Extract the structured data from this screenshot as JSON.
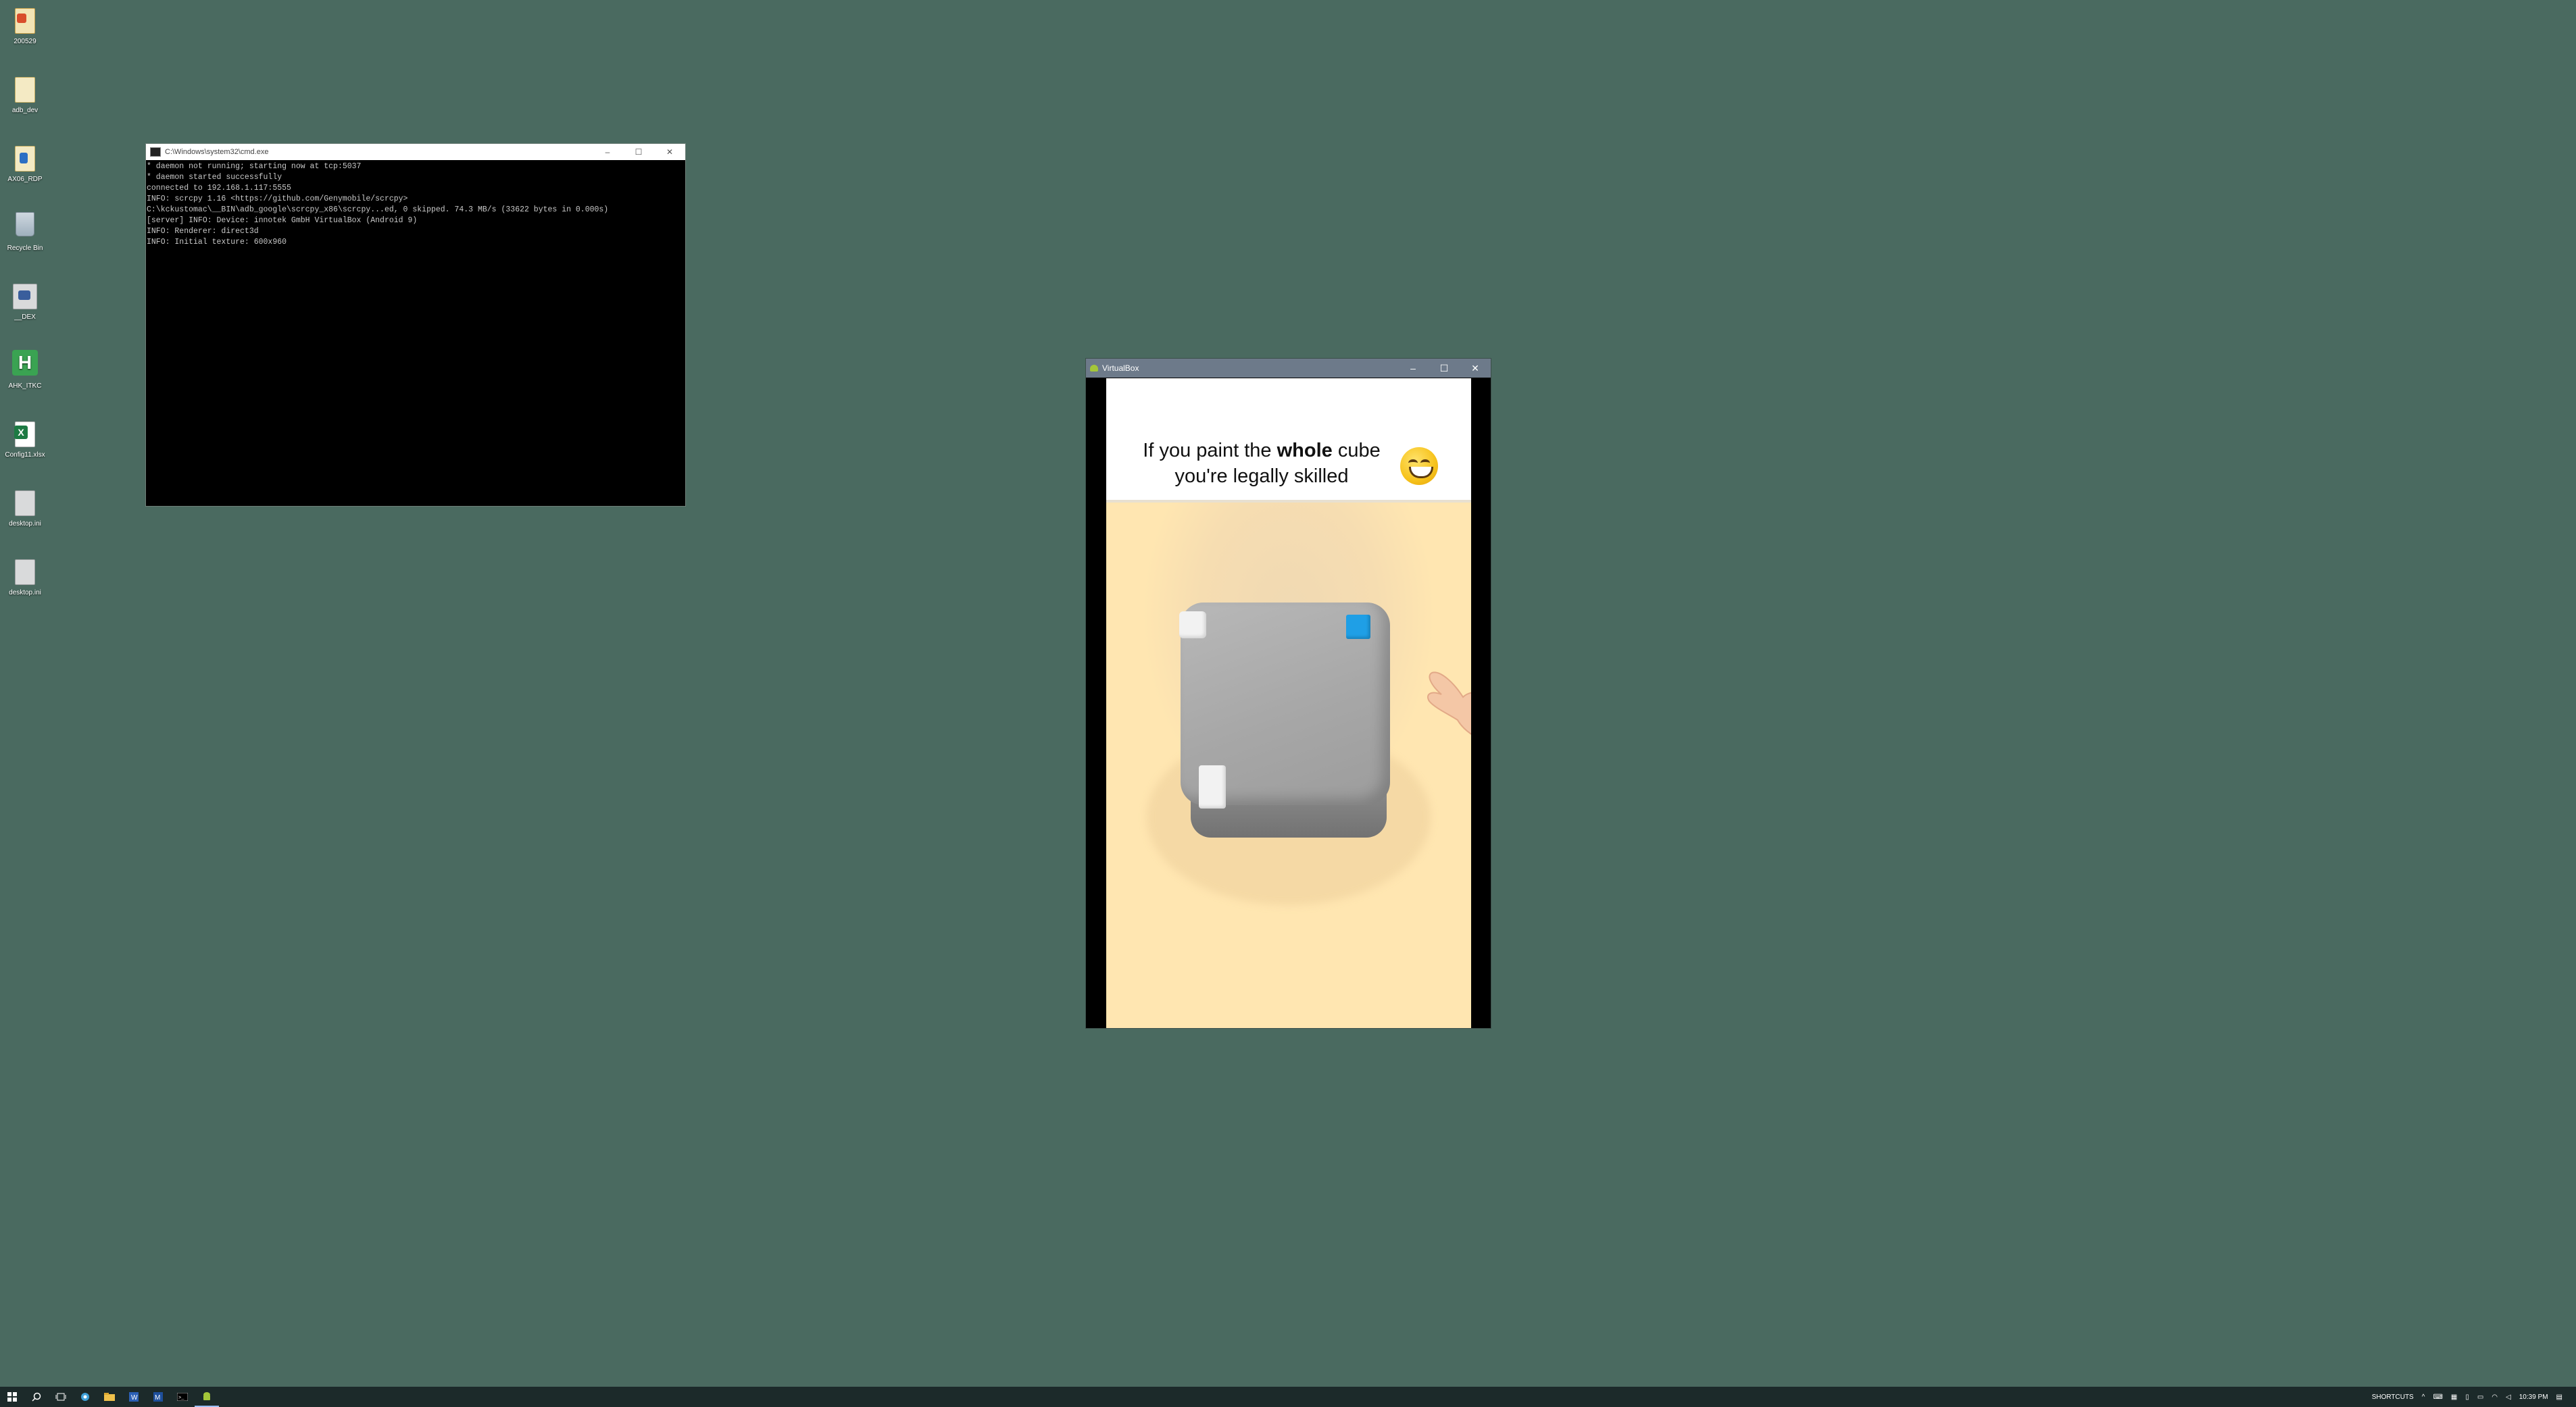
{
  "desktop": {
    "icons": [
      {
        "label": "200529",
        "icon": "folder-archive-icon"
      },
      {
        "label": "adb_dev",
        "icon": "text-file-icon"
      },
      {
        "label": "AX06_RDP",
        "icon": "remote-desktop-icon"
      },
      {
        "label": "Recycle Bin",
        "icon": "recycle-bin-icon"
      },
      {
        "label": "__DEX",
        "icon": "folder-shortcut-icon"
      },
      {
        "label": "AHK_ITKC",
        "icon": "autohotkey-icon"
      },
      {
        "label": "Config11.xlsx",
        "icon": "excel-file-icon"
      },
      {
        "label": "desktop.ini",
        "icon": "settings-file-icon"
      },
      {
        "label": "desktop.ini",
        "icon": "settings-file-icon"
      }
    ]
  },
  "cmd_window": {
    "title": "C:\\Windows\\system32\\cmd.exe",
    "lines": [
      "* daemon not running; starting now at tcp:5037",
      "* daemon started successfully",
      "connected to 192.168.1.117:5555",
      "INFO: scrcpy 1.16 <https://github.com/Genymobile/scrcpy>",
      "C:\\kckustomac\\__BIN\\adb_google\\scrcpy_x86\\scrcpy...ed, 0 skipped. 74.3 MB/s (33622 bytes in 0.000s)",
      "[server] INFO: Device: innotek GmbH VirtualBox (Android 9)",
      "INFO: Renderer: direct3d",
      "INFO: Initial texture: 600x960"
    ]
  },
  "vbox_window": {
    "title": "VirtualBox",
    "caption_pre": "If you paint the ",
    "caption_bold": "whole",
    "caption_post": " cube",
    "caption_line2": "you're legally skilled"
  },
  "window_controls": {
    "minimize": "–",
    "maximize": "☐",
    "close": "✕"
  },
  "taskbar": {
    "shortcuts_label": "SHORTCUTS",
    "clock": "10:39 PM"
  },
  "colors": {
    "desktop": "#4a6a60",
    "taskbar": "#1c2a2a",
    "game_background": "#ffe6b1",
    "paint_blue": "#1f9fe6",
    "cube_gray": "#a7a7a7"
  }
}
